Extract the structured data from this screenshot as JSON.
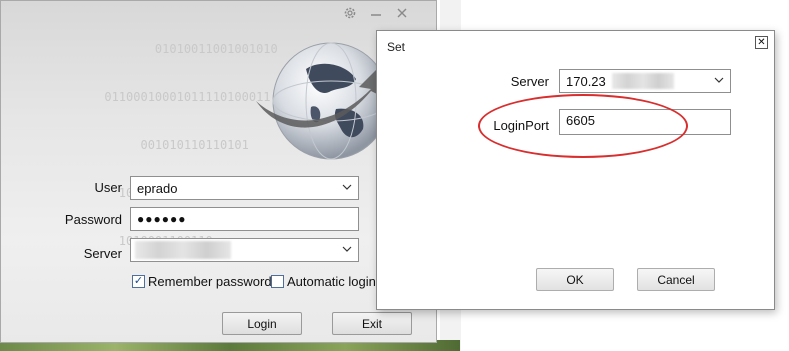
{
  "login_window": {
    "binary_lines": [
      "             01010011001001010",
      "      01100010001011110100011",
      "           001010110110101",
      "        10001011110000111001000",
      "        1010001100110"
    ],
    "title_icons": [
      "gear-icon",
      "minimize-icon",
      "close-icon"
    ],
    "form": {
      "user_label": "User",
      "user_value": "eprado",
      "password_label": "Password",
      "password_value": "●●●●●●",
      "server_label": "Server",
      "server_value": ""
    },
    "remember_password": {
      "label": "Remember password",
      "checked": true
    },
    "automatic_login": {
      "label": "Automatic login",
      "checked": false
    },
    "login_button": "Login",
    "exit_button": "Exit"
  },
  "set_dialog": {
    "title": "Set",
    "server_label": "Server",
    "server_value": "170.23",
    "loginport_label": "LoginPort",
    "loginport_value": "6605",
    "ok_button": "OK",
    "cancel_button": "Cancel"
  },
  "colors": {
    "annotation_ellipse": "#d92e2e",
    "checkbox_accent": "#1b4f8c"
  }
}
